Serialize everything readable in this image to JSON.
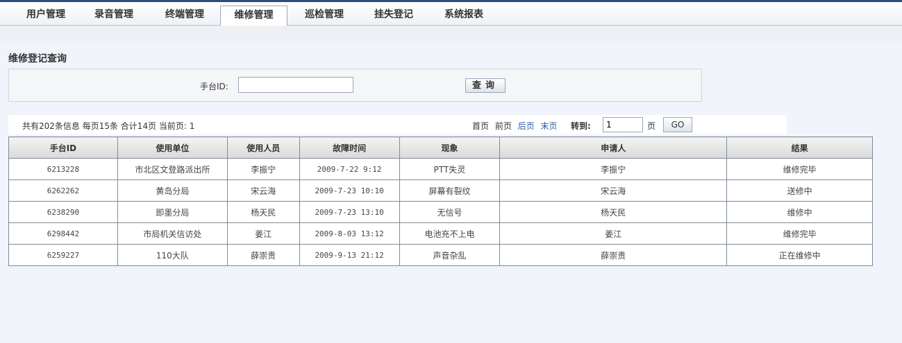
{
  "nav": {
    "tabs": [
      {
        "label": "用户管理"
      },
      {
        "label": "录音管理"
      },
      {
        "label": "终端管理"
      },
      {
        "label": "维修管理"
      },
      {
        "label": "巡检管理"
      },
      {
        "label": "挂失登记"
      },
      {
        "label": "系统报表"
      }
    ],
    "active_tab": "维修管理"
  },
  "section": {
    "title": "维修登记查询"
  },
  "search": {
    "label": "手台ID:",
    "value": "",
    "button_label": "查询"
  },
  "pager": {
    "info": "共有202条信息 每页15条 合计14页  当前页: 1",
    "first": "首页",
    "prev": "前页",
    "next": "后页",
    "last": "末页",
    "goto_label": "转到:",
    "goto_value": "1",
    "page_suffix": "页",
    "go_label": "GO"
  },
  "table": {
    "columns": [
      "手台ID",
      "使用单位",
      "使用人员",
      "故障时间",
      "现象",
      "申请人",
      "结果"
    ],
    "rows": [
      [
        "6213228",
        "市北区文登路派出所",
        "李振宁",
        "2009-7-22 9:12",
        "PTT失灵",
        "李振宁",
        "维修完毕"
      ],
      [
        "6262262",
        "黄岛分局",
        "宋云海",
        "2009-7-23 10:10",
        "屏幕有裂纹",
        "宋云海",
        "送修中"
      ],
      [
        "6238290",
        "即墨分局",
        "杨天民",
        "2009-7-23 13:10",
        "无信号",
        "杨天民",
        "维修中"
      ],
      [
        "6298442",
        "市局机关信访处",
        "姜江",
        "2009-8-03 13:12",
        "电池充不上电",
        "姜江",
        "维修完毕"
      ],
      [
        "6259227",
        "110大队",
        "薛崇贵",
        "2009-9-13 21:12",
        "声音杂乱",
        "薛崇贵",
        "正在维修中"
      ]
    ]
  },
  "colors": {
    "link": "#2a5fa8",
    "header_bar": "#2f4d7a",
    "page_bg": "#f1f4fa"
  }
}
